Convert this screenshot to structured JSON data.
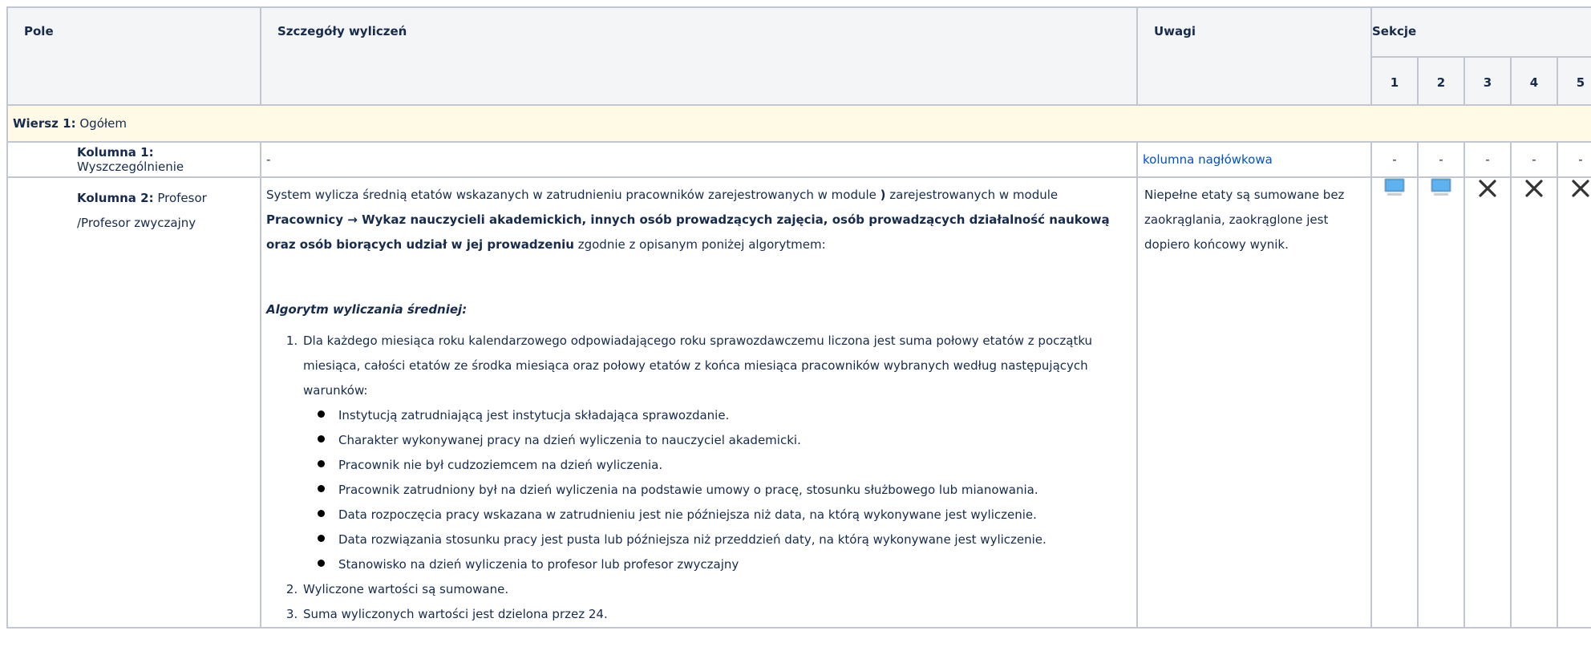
{
  "header": {
    "pole": "Pole",
    "szczegoly": "Szczegóły wyliczeń",
    "uwagi": "Uwagi",
    "sekcje": "Sekcje",
    "sekcje_numbers": [
      "1",
      "2",
      "3",
      "4",
      "5"
    ]
  },
  "row1": {
    "label": "Wiersz 1:",
    "value": "Ogółem"
  },
  "kolumna1": {
    "label": "Kolumna 1:",
    "value": "Wyszczególnienie",
    "details": "-",
    "uwagi": "kolumna nagłówkowa",
    "sections": [
      "-",
      "-",
      "-",
      "-",
      "-"
    ]
  },
  "kolumna2": {
    "label": "Kolumna 2:",
    "value_line1": "Profesor",
    "value_line2": "/Profesor zwyczajny",
    "intro_1": "System wylicza średnią etatów wskazanych w zatrudnieniu pracowników zarejestrowanych w module ",
    "intro_bracket": ")",
    "intro_2": " zarejestrowanych w module ",
    "intro_module": "Pracownicy → Wykaz nauczycieli akademickich, innych osób prowadzących zajęcia, osób prowadzących działalność naukową oraz osób biorących udział w jej prowadzeniu",
    "intro_3": " zgodnie z opisanym poniżej algorytmem:",
    "algo_title": "Algorytm wyliczania średniej:",
    "step1": "Dla każdego miesiąca roku kalendarzowego odpowiadającego roku sprawozdawczemu liczona jest suma połowy etatów z początku miesiąca, całości etatów ze środka miesiąca oraz połowy etatów z końca miesiąca pracowników wybranych według następujących warunków:",
    "conditions": [
      "Instytucją zatrudniającą jest instytucja składająca sprawozdanie.",
      "Charakter wykonywanej pracy na dzień wyliczenia to nauczyciel akademicki.",
      "Pracownik nie był cudzoziemcem na dzień wyliczenia.",
      "Pracownik zatrudniony był na dzień wyliczenia na podstawie umowy o pracę, stosunku służbowego lub mianowania.",
      "Data rozpoczęcia pracy wskazana w zatrudnieniu jest nie późniejsza niż data, na którą wykonywane jest wyliczenie.",
      "Data rozwiązania stosunku pracy jest pusta lub późniejsza niż przeddzień daty, na którą wykonywane jest wyliczenie.",
      "Stanowisko na dzień wyliczenia to profesor lub profesor zwyczajny"
    ],
    "step2": "Wyliczone wartości są sumowane.",
    "step3": "Suma wyliczonych wartości jest dzielona przez 24.",
    "uwagi": "Niepełne etaty są sumowane bez zaokrąglania, zaokrąglone jest dopiero końcowy wynik.",
    "sections": [
      "monitor-icon",
      "monitor-icon",
      "cross-icon",
      "cross-icon",
      "cross-icon"
    ]
  },
  "colors": {
    "border": "#c1c7d0",
    "header_bg": "#f4f5f7",
    "highlight_row_bg": "#fffae6",
    "link": "#0052cc",
    "monitor": "#4a9fe0"
  }
}
